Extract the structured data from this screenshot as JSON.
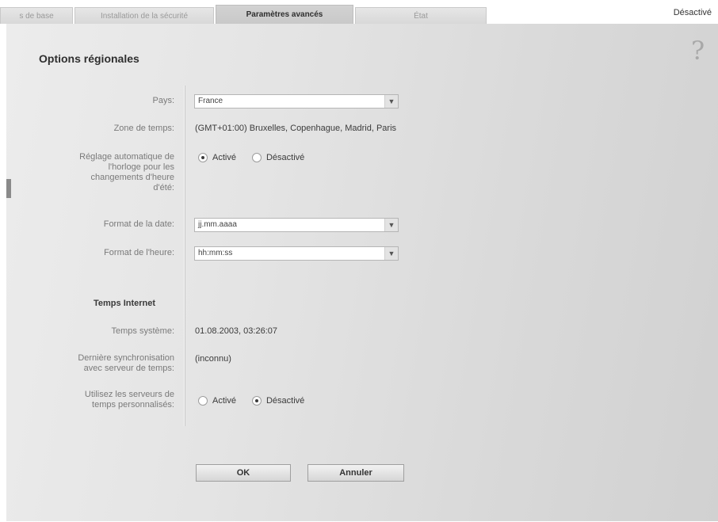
{
  "tabs": [
    {
      "label": "s de base"
    },
    {
      "label": "Installation de la sécurité"
    },
    {
      "label": "Paramètres avancés"
    },
    {
      "label": "État"
    }
  ],
  "status_text": "Désactivé",
  "help_icon": "?",
  "section_title": "Options régionales",
  "fields": {
    "pays": {
      "label": "Pays:",
      "value": "France"
    },
    "zone": {
      "label": "Zone de temps:",
      "value": "(GMT+01:00) Bruxelles, Copenhague, Madrid, Paris"
    },
    "auto_dst": {
      "label_lines": [
        "Réglage automatique de",
        "l'horloge pour les",
        "changements d'heure",
        "d'été:"
      ],
      "options": [
        "Activé",
        "Désactivé"
      ],
      "selected": "Activé"
    },
    "date_format": {
      "label": "Format de la date:",
      "value": "jj.mm.aaaa"
    },
    "time_format": {
      "label": "Format de l'heure:",
      "value": "hh:mm:ss"
    }
  },
  "internet_time": {
    "title": "Temps Internet",
    "system_time": {
      "label": "Temps système:",
      "value": "01.08.2003, 03:26:07"
    },
    "last_sync": {
      "label_lines": [
        "Dernière synchronisation",
        "avec serveur de temps:"
      ],
      "value": "(inconnu)"
    },
    "custom_servers": {
      "label_lines": [
        "Utilisez les serveurs de",
        "temps personnalisés:"
      ],
      "options": [
        "Activé",
        "Désactivé"
      ],
      "selected": "Désactivé"
    }
  },
  "buttons": {
    "ok": "OK",
    "cancel": "Annuler"
  }
}
